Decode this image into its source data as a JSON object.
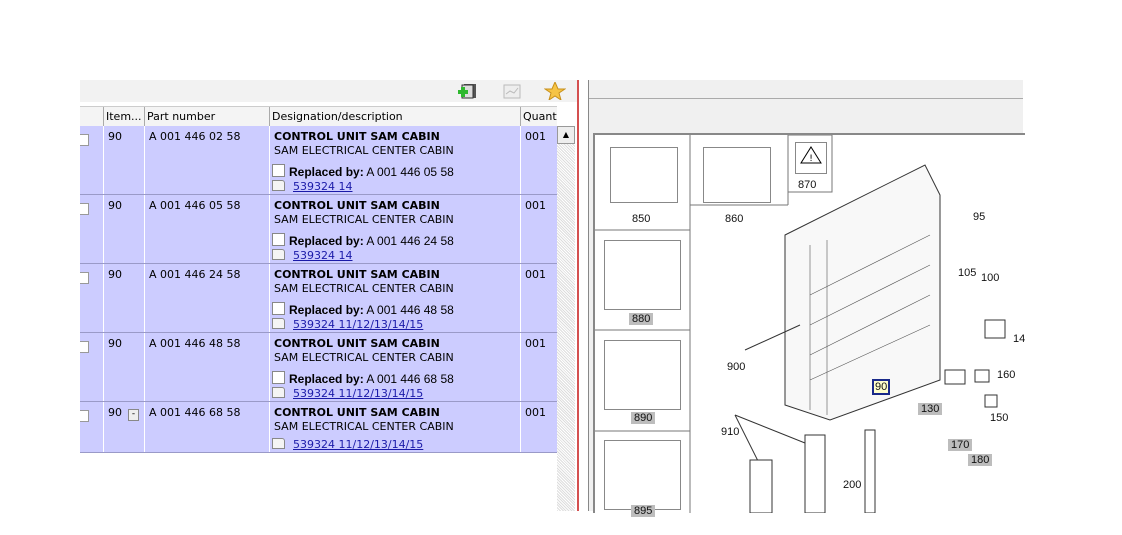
{
  "toolbar": {
    "icons": [
      "add-to-list-icon",
      "chart-icon",
      "favorite-star-icon"
    ]
  },
  "table": {
    "headers": [
      "",
      "Item...",
      "Part number",
      "Designation/description",
      "Quantit"
    ],
    "rows": [
      {
        "item": "90",
        "part_number": "A 001 446 02 58",
        "designation": "CONTROL UNIT SAM CABIN",
        "description": "SAM ELECTRICAL CENTER CABIN",
        "replaced_label": "Replaced by:",
        "replaced_by": "A 001 446 05 58",
        "link": "539324 14",
        "quantity": "001"
      },
      {
        "item": "90",
        "part_number": "A 001 446 05 58",
        "designation": "CONTROL UNIT SAM CABIN",
        "description": "SAM ELECTRICAL CENTER CABIN",
        "replaced_label": "Replaced by:",
        "replaced_by": "A 001 446 24 58",
        "link": "539324 14",
        "quantity": "001"
      },
      {
        "item": "90",
        "part_number": "A 001 446 24 58",
        "designation": "CONTROL UNIT SAM CABIN",
        "description": "SAM ELECTRICAL CENTER CABIN",
        "replaced_label": "Replaced by:",
        "replaced_by": "A 001 446 48 58",
        "link": "539324 11/12/13/14/15",
        "quantity": "001"
      },
      {
        "item": "90",
        "part_number": "A 001 446 48 58",
        "designation": "CONTROL UNIT SAM CABIN",
        "description": "SAM ELECTRICAL CENTER CABIN",
        "replaced_label": "Replaced by:",
        "replaced_by": "A 001 446 68 58",
        "link": "539324 11/12/13/14/15",
        "quantity": "001"
      },
      {
        "item": "90",
        "collapse": "-",
        "part_number": "A 001 446 68 58",
        "designation": "CONTROL UNIT SAM CABIN",
        "description": "SAM ELECTRICAL CENTER CABIN",
        "link": "539324 11/12/13/14/15",
        "quantity": "001"
      }
    ]
  },
  "diagram": {
    "thumbnails": [
      "850",
      "860",
      "870",
      "880",
      "890",
      "895"
    ],
    "callouts": [
      "95",
      "105",
      "100",
      "14",
      "160",
      "900",
      "90",
      "130",
      "150",
      "910",
      "170",
      "180",
      "200"
    ],
    "selected_callout": "90",
    "highlight_color": "#1a2a8a"
  }
}
